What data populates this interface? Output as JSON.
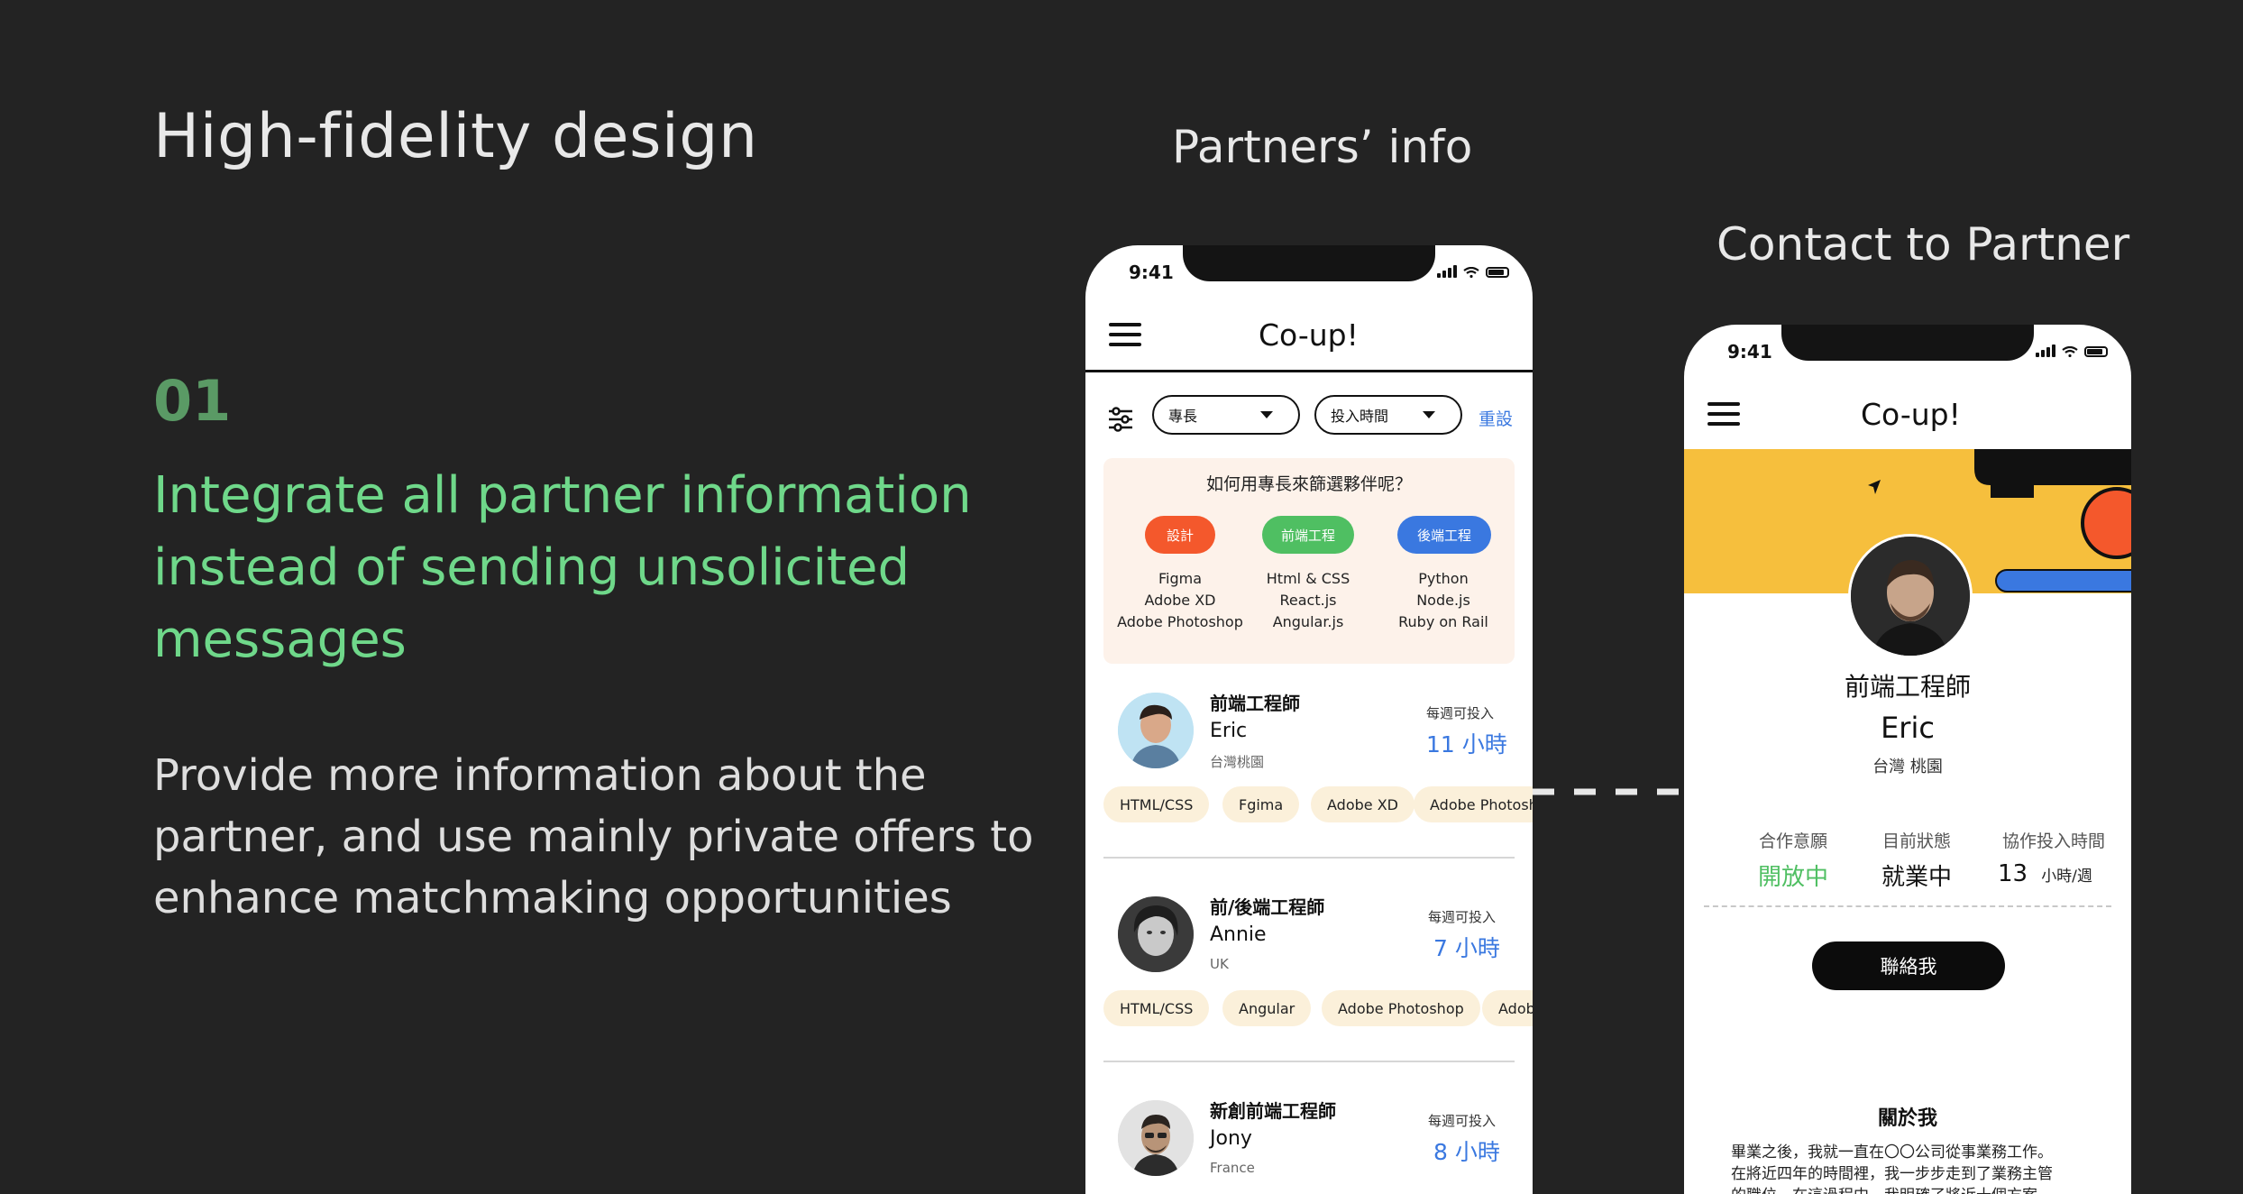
{
  "slide": {
    "title": "High-fidelity design",
    "step_number": "01",
    "headline_lines": [
      "Integrate all partner information",
      "instead of sending unsolicited",
      "messages"
    ],
    "description_lines": [
      "Provide more information about the",
      "partner, and use mainly private offers to",
      "enhance matchmaking opportunities"
    ],
    "label_partners_info": "Partners’ info",
    "label_contact": "Contact to Partner"
  },
  "phone_list": {
    "time": "9:41",
    "app_title": "Co-up!",
    "filters": {
      "skill": "專長",
      "hours": "投入時間",
      "reset": "重設"
    },
    "guide": {
      "title": "如何用專長來篩選夥伴呢？",
      "categories": [
        {
          "label": "設計",
          "color": "#f4582c",
          "items": [
            "Figma",
            "Adobe XD",
            "Adobe Photoshop"
          ]
        },
        {
          "label": "前端工程",
          "color": "#4fbf62",
          "items": [
            "Html & CSS",
            "React.js",
            "Angular.js"
          ]
        },
        {
          "label": "後端工程",
          "color": "#3a78e0",
          "items": [
            "Python",
            "Node.js",
            "Ruby on Rail"
          ]
        }
      ]
    },
    "partners": [
      {
        "role": "前端工程師",
        "name": "Eric",
        "location": "台灣桃園",
        "hours_label": "每週可投入",
        "hours": "11 小時",
        "skills": [
          "HTML/CSS",
          "Fgima",
          "Adobe XD",
          "Adobe Photoshop"
        ]
      },
      {
        "role": "前/後端工程師",
        "name": "Annie",
        "location": "UK",
        "hours_label": "每週可投入",
        "hours": "7 小時",
        "skills": [
          "HTML/CSS",
          "Angular",
          "Adobe Photoshop",
          "Adobe"
        ]
      },
      {
        "role": "新創前端工程師",
        "name": "Jony",
        "location": "France",
        "hours_label": "每週可投入",
        "hours": "8 小時",
        "skills": []
      }
    ]
  },
  "phone_profile": {
    "time": "9:41",
    "app_title": "Co-up!",
    "role": "前端工程師",
    "name": "Eric",
    "location": "台灣 桃園",
    "stats": [
      {
        "label": "合作意願",
        "value": "開放中",
        "color": "#4fbf62"
      },
      {
        "label": "目前狀態",
        "value": "就業中",
        "color": "#111111"
      },
      {
        "label": "協作投入時間",
        "value": "13",
        "unit": "小時/週",
        "color": "#111111"
      }
    ],
    "contact_button": "聯絡我",
    "about_title": "關於我",
    "about_lines": [
      "畢業之後，我就一直在〇〇公司從事業務工作。",
      "在將近四年的時間裡，我一步步走到了業務主管",
      "的職位，在這過程中，我明確了將近十個方案"
    ]
  },
  "colors": {
    "background": "#232323",
    "accent_green": "#6fd88a",
    "link_blue": "#3a78e0",
    "banner_yellow": "#f6bf3d"
  }
}
